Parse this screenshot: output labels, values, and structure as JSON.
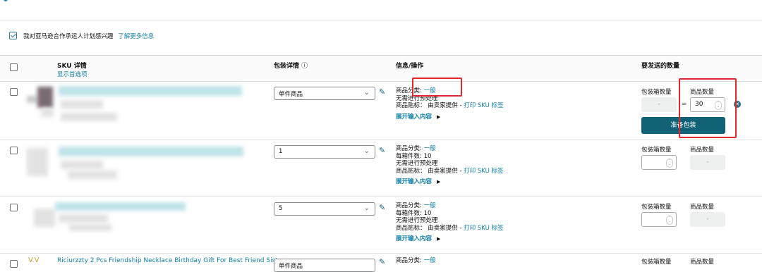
{
  "partner_opt_in": {
    "checked": true,
    "label": "我对亚马逊合作承运人计划感兴趣",
    "link": "了解更多信息"
  },
  "table_header": {
    "sku_details": "SKU 详情",
    "show_preferences": "显示首选项",
    "packing_details": "包装详情",
    "info_icon": "ⓘ",
    "info_actions": "信息/操作",
    "quantity_to_send": "要发送的数量"
  },
  "rows": [
    {
      "packing": "单件商品",
      "category_label": "商品分类:",
      "category_value": "一般",
      "prep": "无需进行预处理",
      "label_line_prefix": "商品贴标：  由卖家提供 -",
      "print_link": "打印 SKU 标签",
      "expand": "展开输入内容",
      "box_qty_label": "包装箱数量",
      "unit_qty_label": "商品数量",
      "box_qty_value": "-",
      "equals": "=",
      "unit_qty_value": "30",
      "ready_button": "准备包装"
    },
    {
      "packing": "1",
      "category_label": "商品分类:",
      "category_value": "一般",
      "units_per_box": "每箱件数: 10",
      "prep": "无需进行预处理",
      "label_line_prefix": "商品贴标：  由卖家提供 -",
      "print_link": "打印 SKU 标签",
      "expand": "展开输入内容",
      "box_qty_label": "包装箱数量",
      "unit_qty_label": "商品数量",
      "unit_qty_value": "-"
    },
    {
      "packing": "5",
      "category_label": "商品分类:",
      "category_value": "一般",
      "units_per_box": "每箱件数: 10",
      "prep": "无需进行预处理",
      "label_line_prefix": "商品贴标：  由卖家提供 -",
      "print_link": "打印 SKU 标签",
      "expand": "展开输入内容",
      "box_qty_label": "包装箱数量",
      "unit_qty_label": "商品数量",
      "unit_qty_value": "-"
    },
    {
      "title": "Riciurzzty 2 Pcs Friendship Necklace Birthday Gift For Best Friend Sister",
      "packing": "单件商品",
      "category_label": "商品分类:",
      "category_value": "一般",
      "box_qty_label": "包装箱数量",
      "unit_qty_label": "商品数量"
    }
  ],
  "icons": {
    "chevron": "⌄",
    "edit": "✎",
    "expand_arrow": "▶",
    "spin": "⌃⌄",
    "clear": "✕"
  },
  "colors": {
    "link": "#0f7fa6",
    "button": "#126277",
    "highlight_box": "#e0282e"
  }
}
